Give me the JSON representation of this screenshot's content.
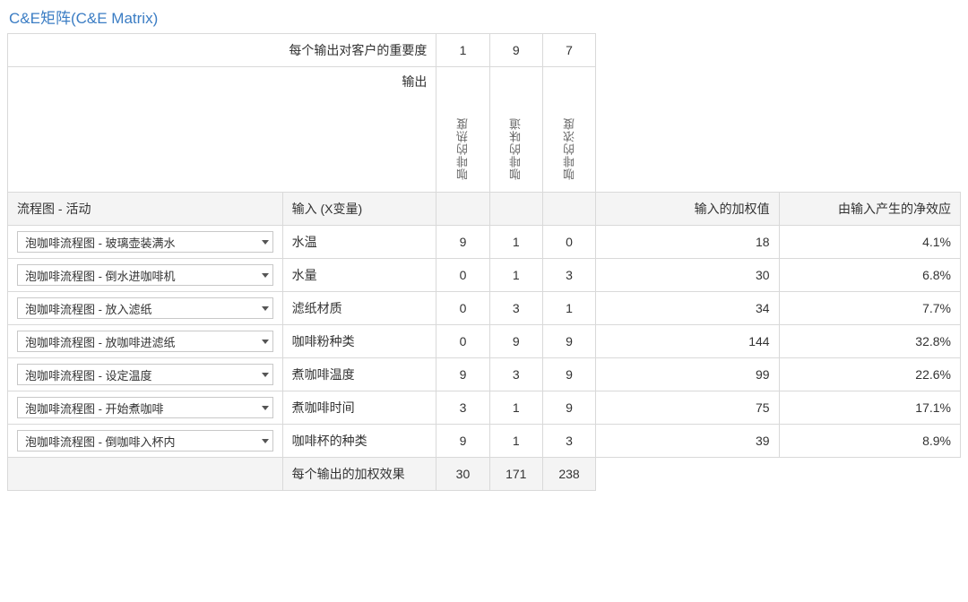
{
  "title": "C&E矩阵(C&E Matrix)",
  "header": {
    "importance_label": "每个输出对客户的重要度",
    "output_label": "输出",
    "activity_col": "流程图 - 活动",
    "input_col": "输入 (X变量)",
    "weighted_col": "输入的加权值",
    "neteffect_col": "由输入产生的净效应",
    "footer_label": "每个输出的加权效果"
  },
  "importance": [
    "1",
    "9",
    "7"
  ],
  "output_names": [
    "咖啡的热度",
    "咖啡的味道",
    "咖啡的浓度"
  ],
  "rows": [
    {
      "activity": "泡咖啡流程图 - 玻璃壶装满水",
      "input": "水温",
      "scores": [
        "9",
        "1",
        "0"
      ],
      "weighted": "18",
      "net": "4.1%"
    },
    {
      "activity": "泡咖啡流程图 - 倒水进咖啡机",
      "input": "水量",
      "scores": [
        "0",
        "1",
        "3"
      ],
      "weighted": "30",
      "net": "6.8%"
    },
    {
      "activity": "泡咖啡流程图 - 放入滤纸",
      "input": "滤纸材质",
      "scores": [
        "0",
        "3",
        "1"
      ],
      "weighted": "34",
      "net": "7.7%"
    },
    {
      "activity": "泡咖啡流程图 - 放咖啡进滤纸",
      "input": "咖啡粉种类",
      "scores": [
        "0",
        "9",
        "9"
      ],
      "weighted": "144",
      "net": "32.8%"
    },
    {
      "activity": "泡咖啡流程图 - 设定温度",
      "input": "煮咖啡温度",
      "scores": [
        "9",
        "3",
        "9"
      ],
      "weighted": "99",
      "net": "22.6%"
    },
    {
      "activity": "泡咖啡流程图 - 开始煮咖啡",
      "input": "煮咖啡时间",
      "scores": [
        "3",
        "1",
        "9"
      ],
      "weighted": "75",
      "net": "17.1%"
    },
    {
      "activity": "泡咖啡流程图 - 倒咖啡入杯内",
      "input": "咖啡杯的种类",
      "scores": [
        "9",
        "1",
        "3"
      ],
      "weighted": "39",
      "net": "8.9%"
    }
  ],
  "footer_totals": [
    "30",
    "171",
    "238"
  ],
  "chart_data": {
    "type": "table",
    "title": "C&E矩阵(C&E Matrix)",
    "outputs": [
      {
        "name": "咖啡的热度",
        "importance": 1
      },
      {
        "name": "咖啡的味道",
        "importance": 9
      },
      {
        "name": "咖啡的浓度",
        "importance": 7
      }
    ],
    "inputs": [
      {
        "activity": "泡咖啡流程图 - 玻璃壶装满水",
        "x": "水温",
        "scores": [
          9,
          1,
          0
        ],
        "weighted": 18,
        "net_effect_pct": 4.1
      },
      {
        "activity": "泡咖啡流程图 - 倒水进咖啡机",
        "x": "水量",
        "scores": [
          0,
          1,
          3
        ],
        "weighted": 30,
        "net_effect_pct": 6.8
      },
      {
        "activity": "泡咖啡流程图 - 放入滤纸",
        "x": "滤纸材质",
        "scores": [
          0,
          3,
          1
        ],
        "weighted": 34,
        "net_effect_pct": 7.7
      },
      {
        "activity": "泡咖啡流程图 - 放咖啡进滤纸",
        "x": "咖啡粉种类",
        "scores": [
          0,
          9,
          9
        ],
        "weighted": 144,
        "net_effect_pct": 32.8
      },
      {
        "activity": "泡咖啡流程图 - 设定温度",
        "x": "煮咖啡温度",
        "scores": [
          9,
          3,
          9
        ],
        "weighted": 99,
        "net_effect_pct": 22.6
      },
      {
        "activity": "泡咖啡流程图 - 开始煮咖啡",
        "x": "煮咖啡时间",
        "scores": [
          3,
          1,
          9
        ],
        "weighted": 75,
        "net_effect_pct": 17.1
      },
      {
        "activity": "泡咖啡流程图 - 倒咖啡入杯内",
        "x": "咖啡杯的种类",
        "scores": [
          9,
          1,
          3
        ],
        "weighted": 39,
        "net_effect_pct": 8.9
      }
    ],
    "output_weighted_totals": [
      30,
      171,
      238
    ]
  }
}
